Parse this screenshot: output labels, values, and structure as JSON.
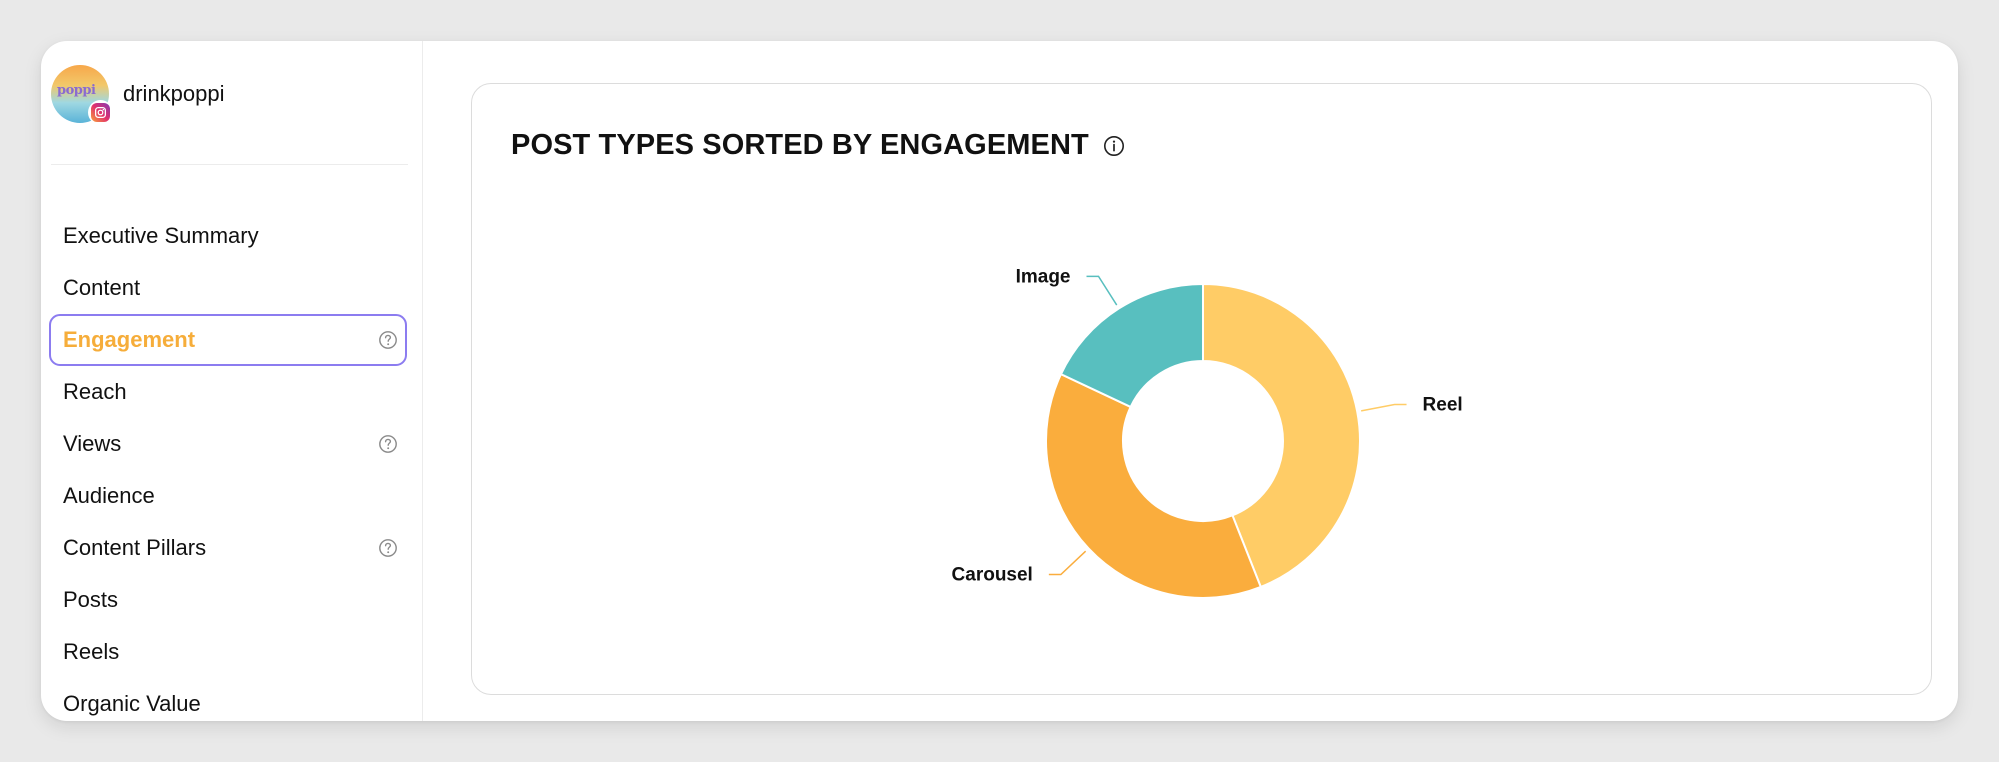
{
  "sidebar": {
    "profile": {
      "name": "drinkpoppi",
      "avatar_text": "poppi"
    },
    "items": [
      {
        "label": "Executive Summary",
        "help": false,
        "active": false
      },
      {
        "label": "Content",
        "help": false,
        "active": false
      },
      {
        "label": "Engagement",
        "help": true,
        "active": true
      },
      {
        "label": "Reach",
        "help": false,
        "active": false
      },
      {
        "label": "Views",
        "help": true,
        "active": false
      },
      {
        "label": "Audience",
        "help": false,
        "active": false
      },
      {
        "label": "Content Pillars",
        "help": true,
        "active": false
      },
      {
        "label": "Posts",
        "help": false,
        "active": false
      },
      {
        "label": "Reels",
        "help": false,
        "active": false
      },
      {
        "label": "Organic Value",
        "help": false,
        "active": false
      }
    ]
  },
  "main": {
    "card": {
      "title": "POST TYPES SORTED BY ENGAGEMENT"
    }
  },
  "colors": {
    "accent_active": "#f6ad3a",
    "active_border": "#8c7cf0",
    "reel": "#ffcc66",
    "carousel": "#faad3d",
    "image": "#58bfbf"
  },
  "chart_data": {
    "type": "pie",
    "donut": true,
    "title": "POST TYPES SORTED BY ENGAGEMENT",
    "categories": [
      "Reel",
      "Carousel",
      "Image"
    ],
    "values": [
      44,
      38,
      18
    ],
    "colors": [
      "#ffcc66",
      "#faad3d",
      "#58bfbf"
    ]
  }
}
